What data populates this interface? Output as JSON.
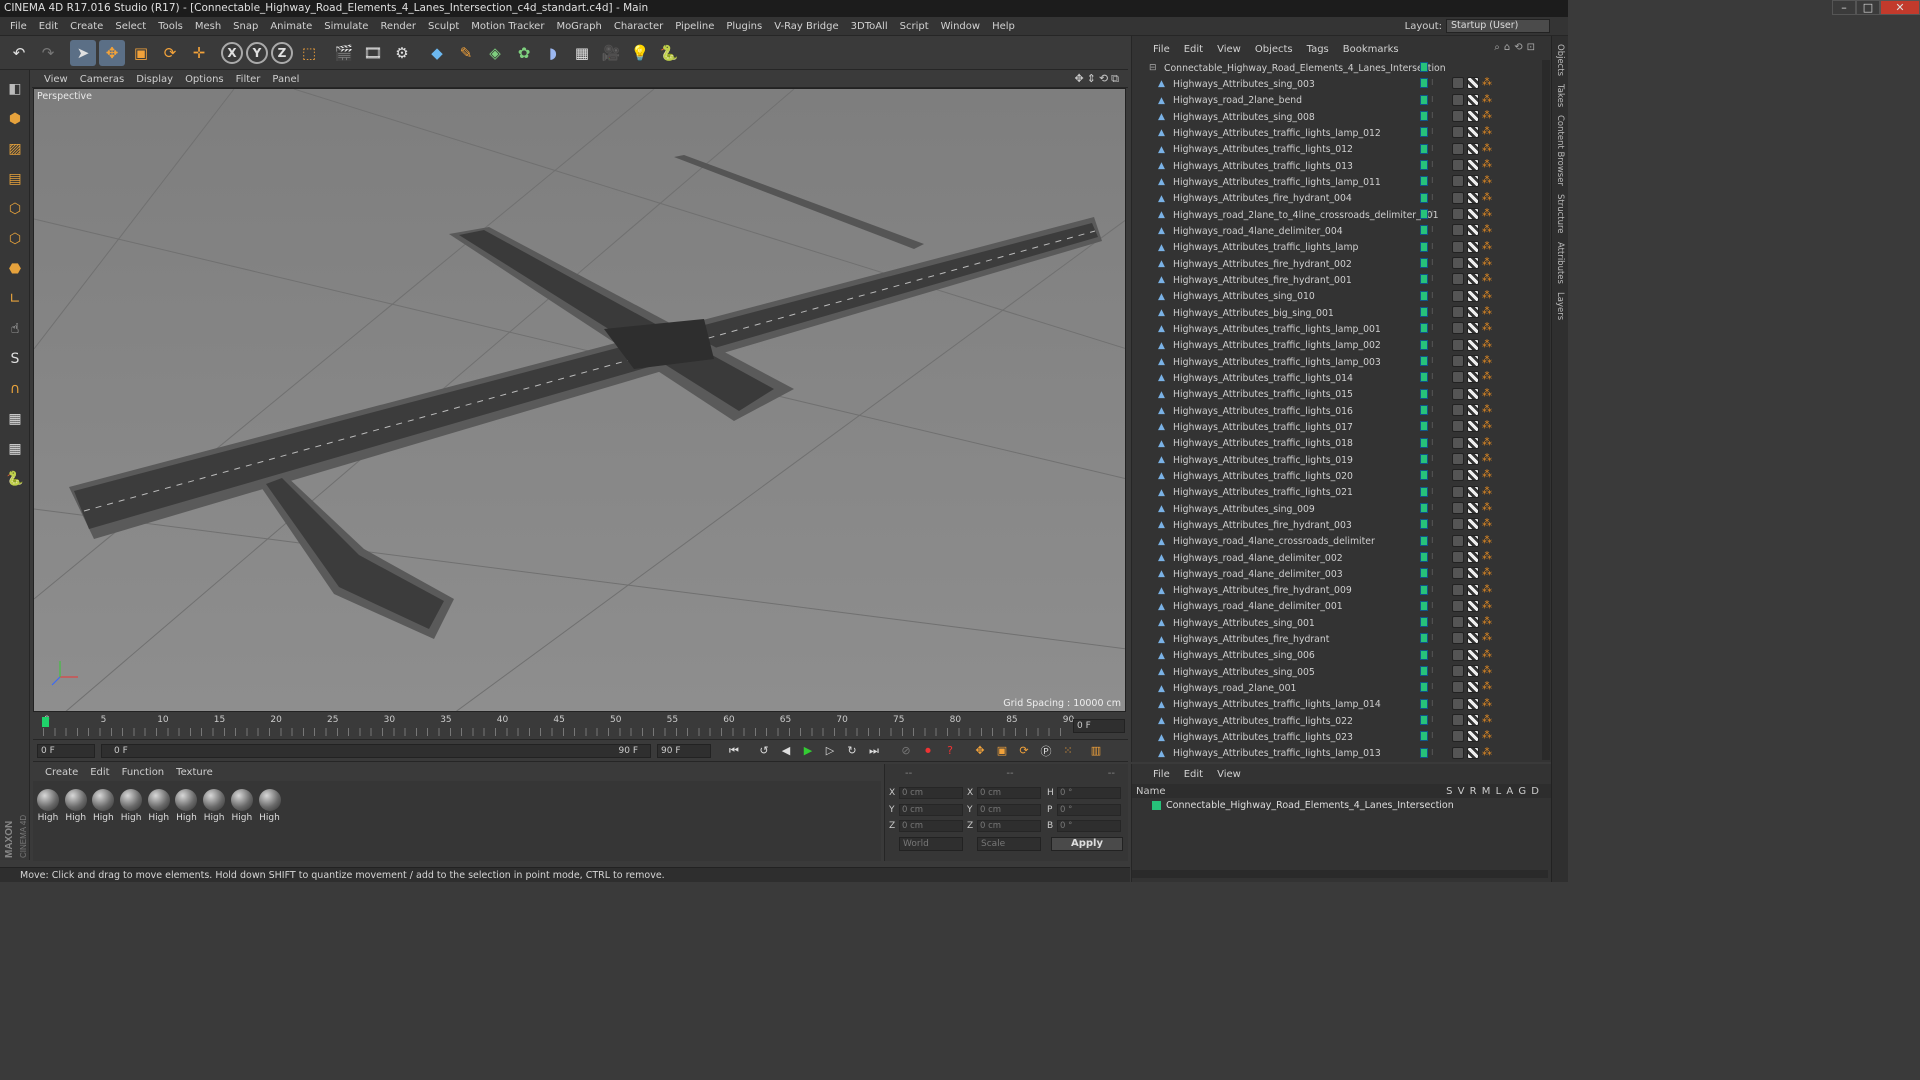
{
  "window": {
    "title": "CINEMA 4D R17.016 Studio (R17) - [Connectable_Highway_Road_Elements_4_Lanes_Intersection_c4d_standart.c4d] - Main"
  },
  "menu": [
    "File",
    "Edit",
    "Create",
    "Select",
    "Tools",
    "Mesh",
    "Snap",
    "Animate",
    "Simulate",
    "Render",
    "Sculpt",
    "Motion Tracker",
    "MoGraph",
    "Character",
    "Pipeline",
    "Plugins",
    "V-Ray Bridge",
    "3DToAll",
    "Script",
    "Window",
    "Help"
  ],
  "layout": {
    "label": "Layout:",
    "value": "Startup (User)"
  },
  "viewport": {
    "menu": [
      "View",
      "Cameras",
      "Display",
      "Options",
      "Filter",
      "Panel"
    ],
    "label": "Perspective",
    "grid_spacing": "Grid Spacing : 10000 cm"
  },
  "timeline": {
    "ticks": [
      "0",
      "5",
      "10",
      "15",
      "20",
      "25",
      "30",
      "35",
      "40",
      "45",
      "50",
      "55",
      "60",
      "65",
      "70",
      "75",
      "80",
      "85",
      "90"
    ],
    "end_field": "0 F",
    "start": "0 F",
    "range_start": "0 F",
    "range_end": "90 F",
    "end": "90 F"
  },
  "materials": {
    "menu": [
      "Create",
      "Edit",
      "Function",
      "Texture"
    ],
    "items": [
      "High",
      "High",
      "High",
      "High",
      "High",
      "High",
      "High",
      "High",
      "High"
    ]
  },
  "coords": {
    "header": [
      "--",
      "--",
      "--"
    ],
    "rows": [
      {
        "a": "X",
        "v1": "0 cm",
        "b": "X",
        "v2": "0 cm",
        "c": "H",
        "v3": "0 °"
      },
      {
        "a": "Y",
        "v1": "0 cm",
        "b": "Y",
        "v2": "0 cm",
        "c": "P",
        "v3": "0 °"
      },
      {
        "a": "Z",
        "v1": "0 cm",
        "b": "Z",
        "v2": "0 cm",
        "c": "B",
        "v3": "0 °"
      }
    ],
    "mode": "World",
    "scale": "Scale",
    "apply": "Apply"
  },
  "objects": {
    "menu": [
      "File",
      "Edit",
      "View",
      "Objects",
      "Tags",
      "Bookmarks"
    ],
    "root": "Connectable_Highway_Road_Elements_4_Lanes_Intersection",
    "items": [
      "Highways_Attributes_sing_003",
      "Highways_road_2lane_bend",
      "Highways_Attributes_sing_008",
      "Highways_Attributes_traffic_lights_lamp_012",
      "Highways_Attributes_traffic_lights_012",
      "Highways_Attributes_traffic_lights_013",
      "Highways_Attributes_traffic_lights_lamp_011",
      "Highways_Attributes_fire_hydrant_004",
      "Highways_road_2lane_to_4line_crossroads_delimiter_001",
      "Highways_road_4lane_delimiter_004",
      "Highways_Attributes_traffic_lights_lamp",
      "Highways_Attributes_fire_hydrant_002",
      "Highways_Attributes_fire_hydrant_001",
      "Highways_Attributes_sing_010",
      "Highways_Attributes_big_sing_001",
      "Highways_Attributes_traffic_lights_lamp_001",
      "Highways_Attributes_traffic_lights_lamp_002",
      "Highways_Attributes_traffic_lights_lamp_003",
      "Highways_Attributes_traffic_lights_014",
      "Highways_Attributes_traffic_lights_015",
      "Highways_Attributes_traffic_lights_016",
      "Highways_Attributes_traffic_lights_017",
      "Highways_Attributes_traffic_lights_018",
      "Highways_Attributes_traffic_lights_019",
      "Highways_Attributes_traffic_lights_020",
      "Highways_Attributes_traffic_lights_021",
      "Highways_Attributes_sing_009",
      "Highways_Attributes_fire_hydrant_003",
      "Highways_road_4lane_crossroads_delimiter",
      "Highways_road_4lane_delimiter_002",
      "Highways_road_4lane_delimiter_003",
      "Highways_Attributes_fire_hydrant_009",
      "Highways_road_4lane_delimiter_001",
      "Highways_Attributes_sing_001",
      "Highways_Attributes_fire_hydrant",
      "Highways_Attributes_sing_006",
      "Highways_Attributes_sing_005",
      "Highways_road_2lane_001",
      "Highways_Attributes_traffic_lights_lamp_014",
      "Highways_Attributes_traffic_lights_022",
      "Highways_Attributes_traffic_lights_023",
      "Highways_Attributes_traffic_lights_lamp_013"
    ]
  },
  "layers": {
    "menu": [
      "File",
      "Edit",
      "View"
    ],
    "header_name": "Name",
    "header_cols": "S V R M L A G D",
    "row": "Connectable_Highway_Road_Elements_4_Lanes_Intersection"
  },
  "right_tabs": [
    "Objects",
    "Takes",
    "Content Browser",
    "Structure",
    "Attributes",
    "Layers"
  ],
  "status": "Move: Click and drag to move elements. Hold down SHIFT to quantize movement / add to the selection in point mode, CTRL to remove.",
  "brand": "MAXON CINEMA 4D",
  "colors": {
    "accent": "#5b6f86",
    "layer_green": "#27c27a",
    "tag_orange": "#e28a22"
  }
}
